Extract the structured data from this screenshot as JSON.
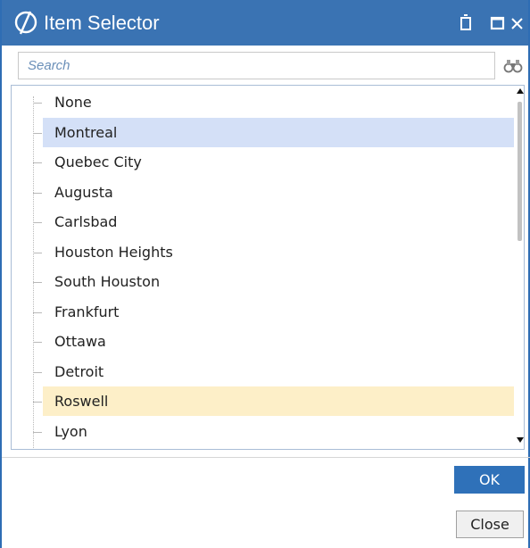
{
  "window": {
    "title": "Item Selector",
    "titlebar_color": "#3a73b3",
    "icons": [
      "app-logo-icon",
      "restore-icon",
      "maximize-icon",
      "close-icon"
    ]
  },
  "search": {
    "placeholder": "Search",
    "value": "",
    "side_icon": "binoculars-icon"
  },
  "tree": {
    "items": [
      {
        "label": "None",
        "state": "normal"
      },
      {
        "label": "Montreal",
        "state": "selected"
      },
      {
        "label": "Quebec City",
        "state": "normal"
      },
      {
        "label": "Augusta",
        "state": "normal"
      },
      {
        "label": "Carlsbad",
        "state": "normal"
      },
      {
        "label": "Houston Heights",
        "state": "normal"
      },
      {
        "label": "South Houston",
        "state": "normal"
      },
      {
        "label": "Frankfurt",
        "state": "normal"
      },
      {
        "label": "Ottawa",
        "state": "normal"
      },
      {
        "label": "Detroit",
        "state": "normal"
      },
      {
        "label": "Roswell",
        "state": "highlighted"
      },
      {
        "label": "Lyon",
        "state": "normal"
      }
    ],
    "selected_color": "#d4e0f7",
    "highlight_color": "#fdefc8"
  },
  "buttons": {
    "ok_label": "OK",
    "close_label": "Close",
    "ok_color": "#2f71b9"
  }
}
